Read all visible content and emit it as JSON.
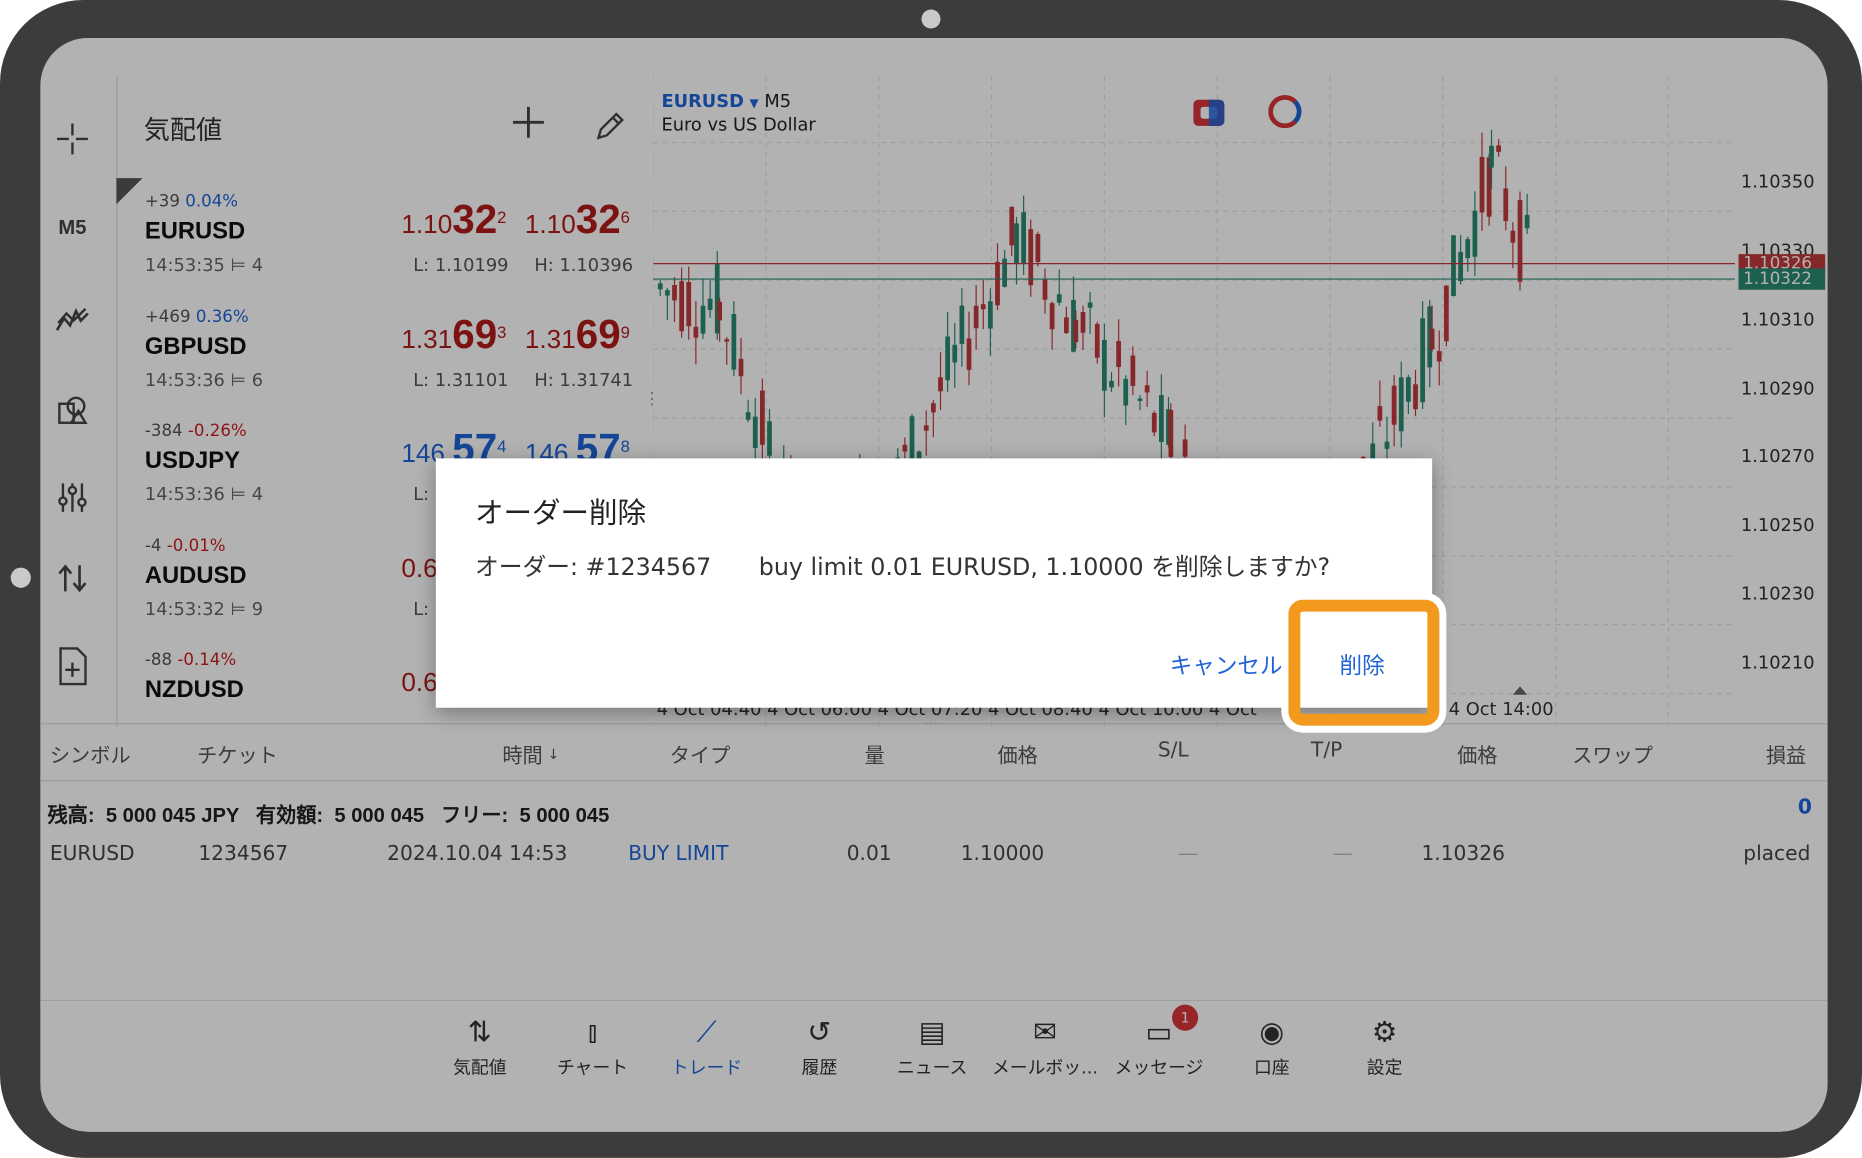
{
  "toolbar": {
    "timeframe": "M5"
  },
  "quotes_panel": {
    "title": "気配値",
    "items": [
      {
        "change": "+39",
        "pct": "0.04%",
        "pct_dir": "up",
        "symbol": "EURUSD",
        "time": "14:53:35",
        "spread": "4",
        "bid_pre": "1.10",
        "bid_big": "32",
        "bid_sup": "2",
        "ask_pre": "1.10",
        "ask_big": "32",
        "ask_sup": "6",
        "low": "L: 1.10199",
        "high": "H: 1.10396",
        "price_color": "#b01c1c"
      },
      {
        "change": "+469",
        "pct": "0.36%",
        "pct_dir": "up",
        "symbol": "GBPUSD",
        "time": "14:53:36",
        "spread": "6",
        "bid_pre": "1.31",
        "bid_big": "69",
        "bid_sup": "3",
        "ask_pre": "1.31",
        "ask_big": "69",
        "ask_sup": "9",
        "low": "L: 1.31101",
        "high": "H: 1.31741",
        "price_color": "#b01c1c"
      },
      {
        "change": "-384",
        "pct": "-0.26%",
        "pct_dir": "down",
        "symbol": "USDJPY",
        "time": "14:53:36",
        "spread": "4",
        "bid_pre": "146.",
        "bid_big": "57",
        "bid_sup": "4",
        "ask_pre": "146.",
        "ask_big": "57",
        "ask_sup": "8",
        "low": "L:",
        "high": "",
        "price_color": "#1f63d8"
      },
      {
        "change": "-4",
        "pct": "-0.01%",
        "pct_dir": "down",
        "symbol": "AUDUSD",
        "time": "14:53:32",
        "spread": "9",
        "bid_pre": "0.6",
        "bid_big": "",
        "bid_sup": "",
        "ask_pre": "",
        "ask_big": "",
        "ask_sup": "",
        "low": "L:",
        "high": "",
        "price_color": "#b01c1c"
      },
      {
        "change": "-88",
        "pct": "-0.14%",
        "pct_dir": "down",
        "symbol": "NZDUSD",
        "time": "",
        "spread": "",
        "bid_pre": "0.6",
        "bid_big": "",
        "bid_sup": "",
        "ask_pre": "",
        "ask_big": "",
        "ask_sup": "",
        "low": "",
        "high": "",
        "price_color": "#b01c1c"
      }
    ]
  },
  "chart": {
    "symbol": "EURUSD",
    "timeframe": "M5",
    "description": "Euro vs US Dollar",
    "price_ticks": [
      "1.10350",
      "1.10330",
      "1.10310",
      "1.10290",
      "1.10270",
      "1.10250",
      "1.10230",
      "1.10210"
    ],
    "ask_label": "1.10326",
    "bid_label": "1.10322",
    "time_axis": "4 Oct 04:40   4 Oct 06:00   4 Oct 07:20   4 Oct 08:40   4 Oct 10:00   4 Oct",
    "time_axis_right": "4 Oct 14:00",
    "up_color": "#2a8a72",
    "down_color": "#c0393b"
  },
  "trade_table": {
    "headers": [
      "シンボル",
      "チケット",
      "時間",
      "タイプ",
      "量",
      "価格",
      "S/L",
      "T/P",
      "価格",
      "スワップ",
      "損益"
    ],
    "summary": "残高:  5 000 045 JPY   有効額:  5 000 045   フリー:  5 000 045",
    "profit_total": "0",
    "row": {
      "symbol": "EURUSD",
      "ticket": "1234567",
      "time": "2024.10.04 14:53",
      "type": "BUY LIMIT",
      "volume": "0.01",
      "price": "1.10000",
      "sl": "—",
      "tp": "—",
      "current": "1.10326",
      "status": "placed"
    }
  },
  "bottom_nav": [
    {
      "icon": "quotes-icon",
      "label": "気配値"
    },
    {
      "icon": "chart-icon",
      "label": "チャート"
    },
    {
      "icon": "trade-icon",
      "label": "トレード",
      "active": true
    },
    {
      "icon": "history-icon",
      "label": "履歴"
    },
    {
      "icon": "news-icon",
      "label": "ニュース"
    },
    {
      "icon": "mailbox-icon",
      "label": "メールボッ..."
    },
    {
      "icon": "messages-icon",
      "label": "メッセージ",
      "badge": "1"
    },
    {
      "icon": "account-icon",
      "label": "口座"
    },
    {
      "icon": "settings-icon",
      "label": "設定"
    }
  ],
  "dialog": {
    "title": "オーダー削除",
    "message_ticket": "オーダー: #1234567",
    "message_text": "buy limit 0.01 EURUSD, 1.10000 を削除しますか?",
    "cancel_label": "キャンセル",
    "delete_label": "削除"
  },
  "colors": {
    "accent": "#1f63d8",
    "highlight": "#f39a1e"
  }
}
